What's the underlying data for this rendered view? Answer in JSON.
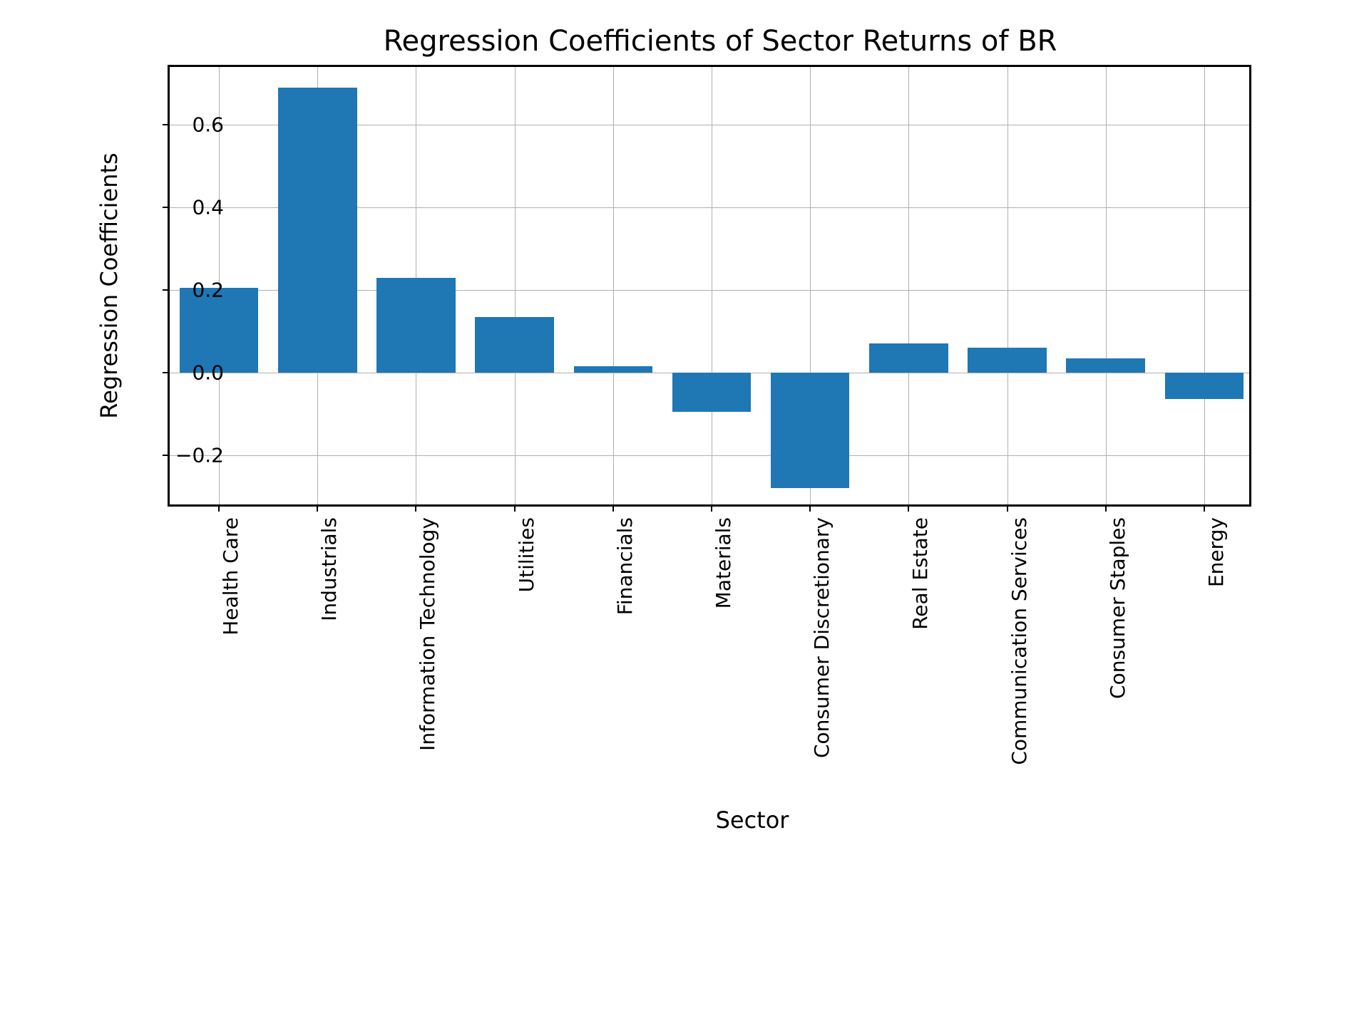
{
  "chart_data": {
    "type": "bar",
    "title": "Regression Coefficients of Sector Returns of BR",
    "xlabel": "Sector",
    "ylabel": "Regression Coefficients",
    "categories": [
      "Health Care",
      "Industrials",
      "Information Technology",
      "Utilities",
      "Financials",
      "Materials",
      "Consumer Discretionary",
      "Real Estate",
      "Communication Services",
      "Consumer Staples",
      "Energy"
    ],
    "values": [
      0.205,
      0.69,
      0.23,
      0.135,
      0.015,
      -0.095,
      -0.28,
      0.07,
      0.06,
      0.035,
      -0.065
    ],
    "ylim": [
      -0.33,
      0.74
    ],
    "yticks": [
      -0.2,
      0.0,
      0.2,
      0.4,
      0.6
    ],
    "ytick_labels": [
      "−0.2",
      "0.0",
      "0.2",
      "0.4",
      "0.6"
    ],
    "bar_color": "#1f77b4",
    "grid": true
  }
}
